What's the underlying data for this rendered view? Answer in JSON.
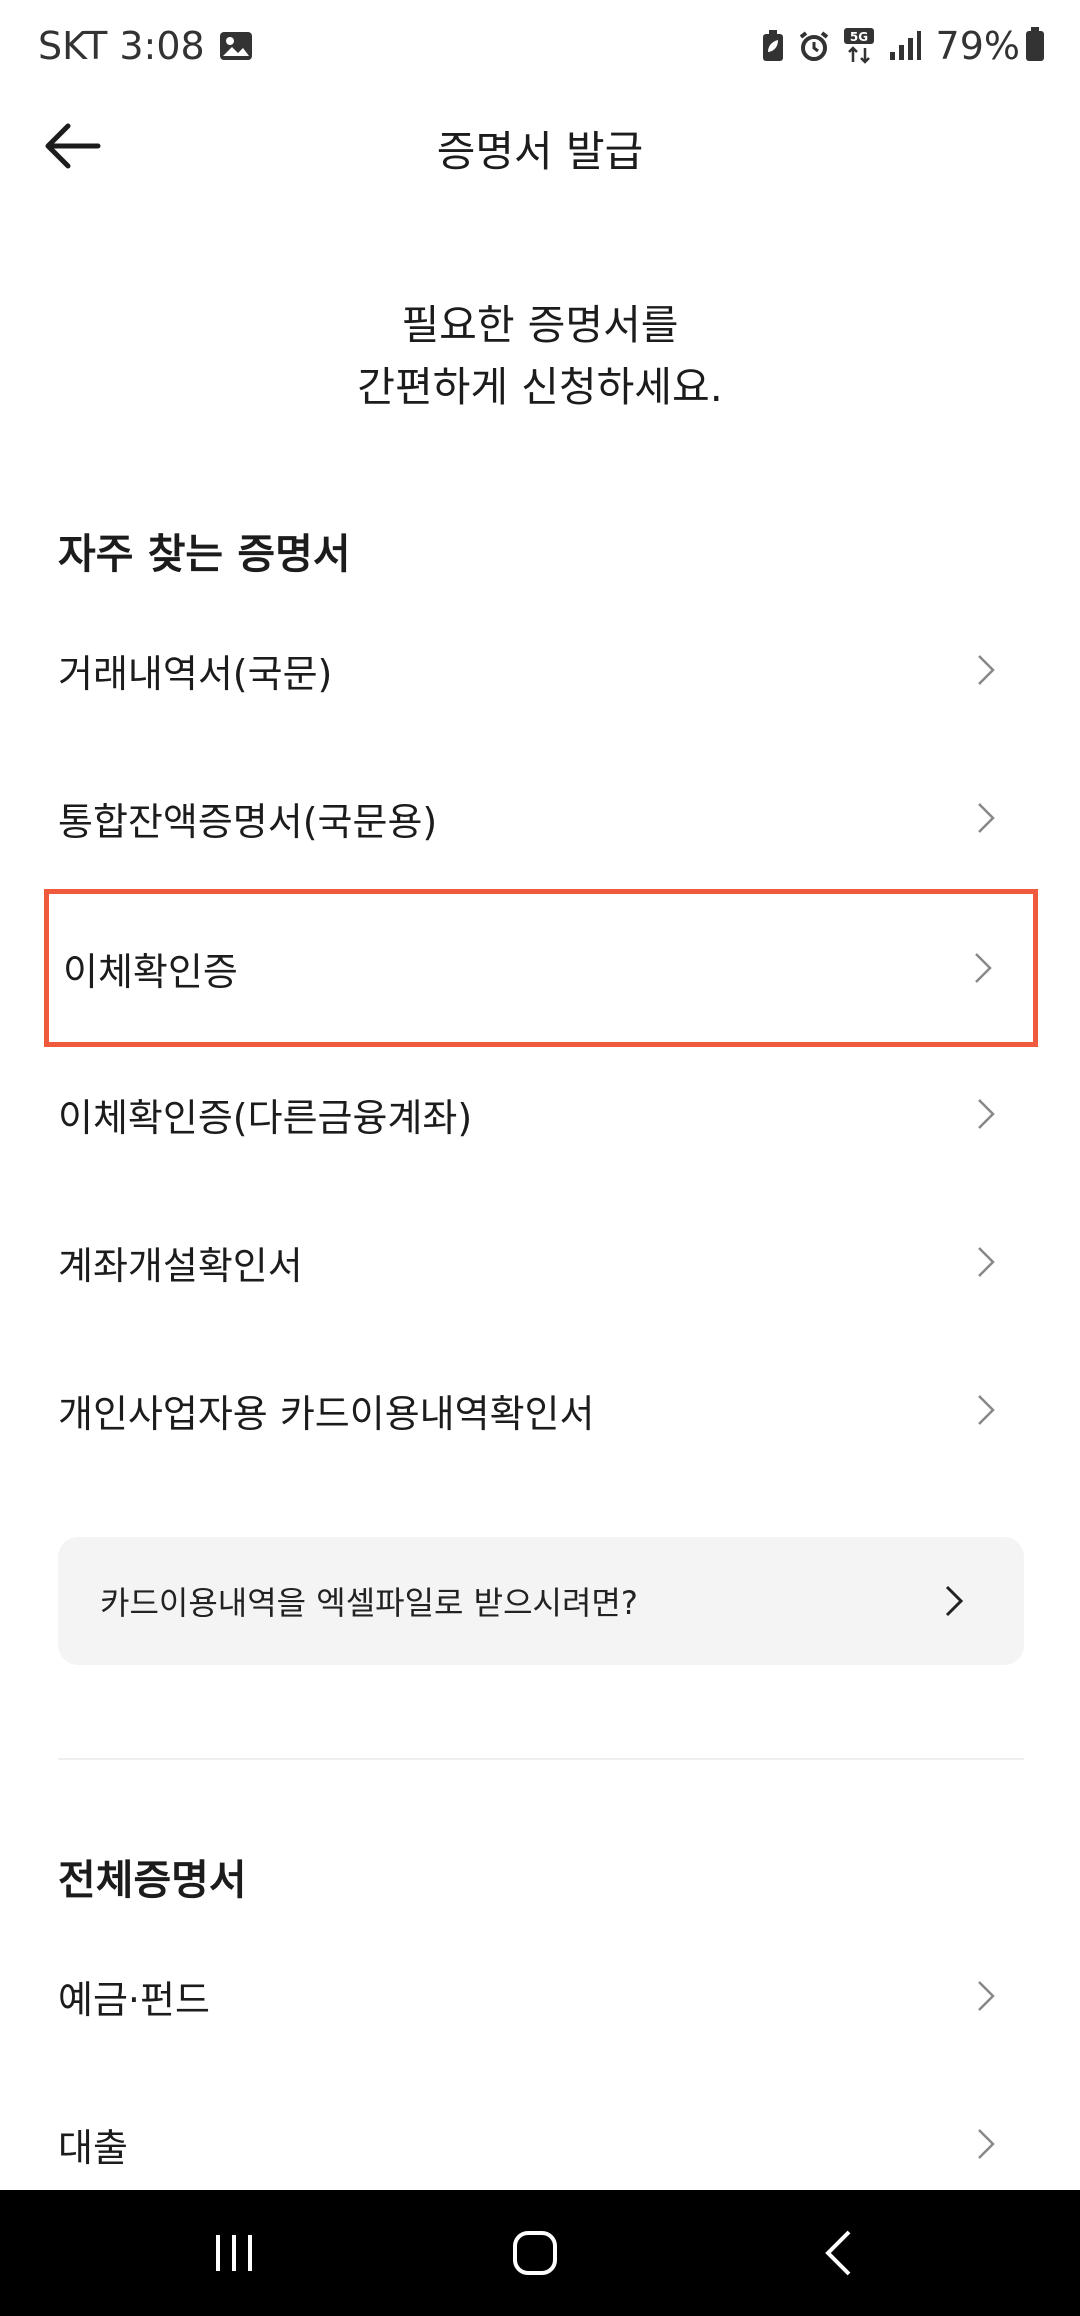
{
  "status_bar": {
    "carrier_time": "SKT 3:08",
    "battery_percent": "79%"
  },
  "app_bar": {
    "title": "증명서 발급"
  },
  "intro": {
    "line1": "필요한 증명서를",
    "line2": "간편하게 신청하세요."
  },
  "frequent": {
    "title": "자주 찾는 증명서",
    "items": [
      {
        "label": "거래내역서(국문)"
      },
      {
        "label": "통합잔액증명서(국문용)"
      },
      {
        "label": "이체확인증"
      },
      {
        "label": "이체확인증(다른금융계좌)"
      },
      {
        "label": "계좌개설확인서"
      },
      {
        "label": "개인사업자용 카드이용내역확인서"
      }
    ]
  },
  "banner": {
    "label": "카드이용내역을 엑셀파일로 받으시려면?"
  },
  "all": {
    "title": "전체증명서",
    "items": [
      {
        "label": "예금·펀드"
      },
      {
        "label": "대출"
      }
    ]
  },
  "colors": {
    "highlight": "#ef5a3c",
    "banner_bg": "#f4f4f4",
    "nav_bg": "#000000"
  }
}
